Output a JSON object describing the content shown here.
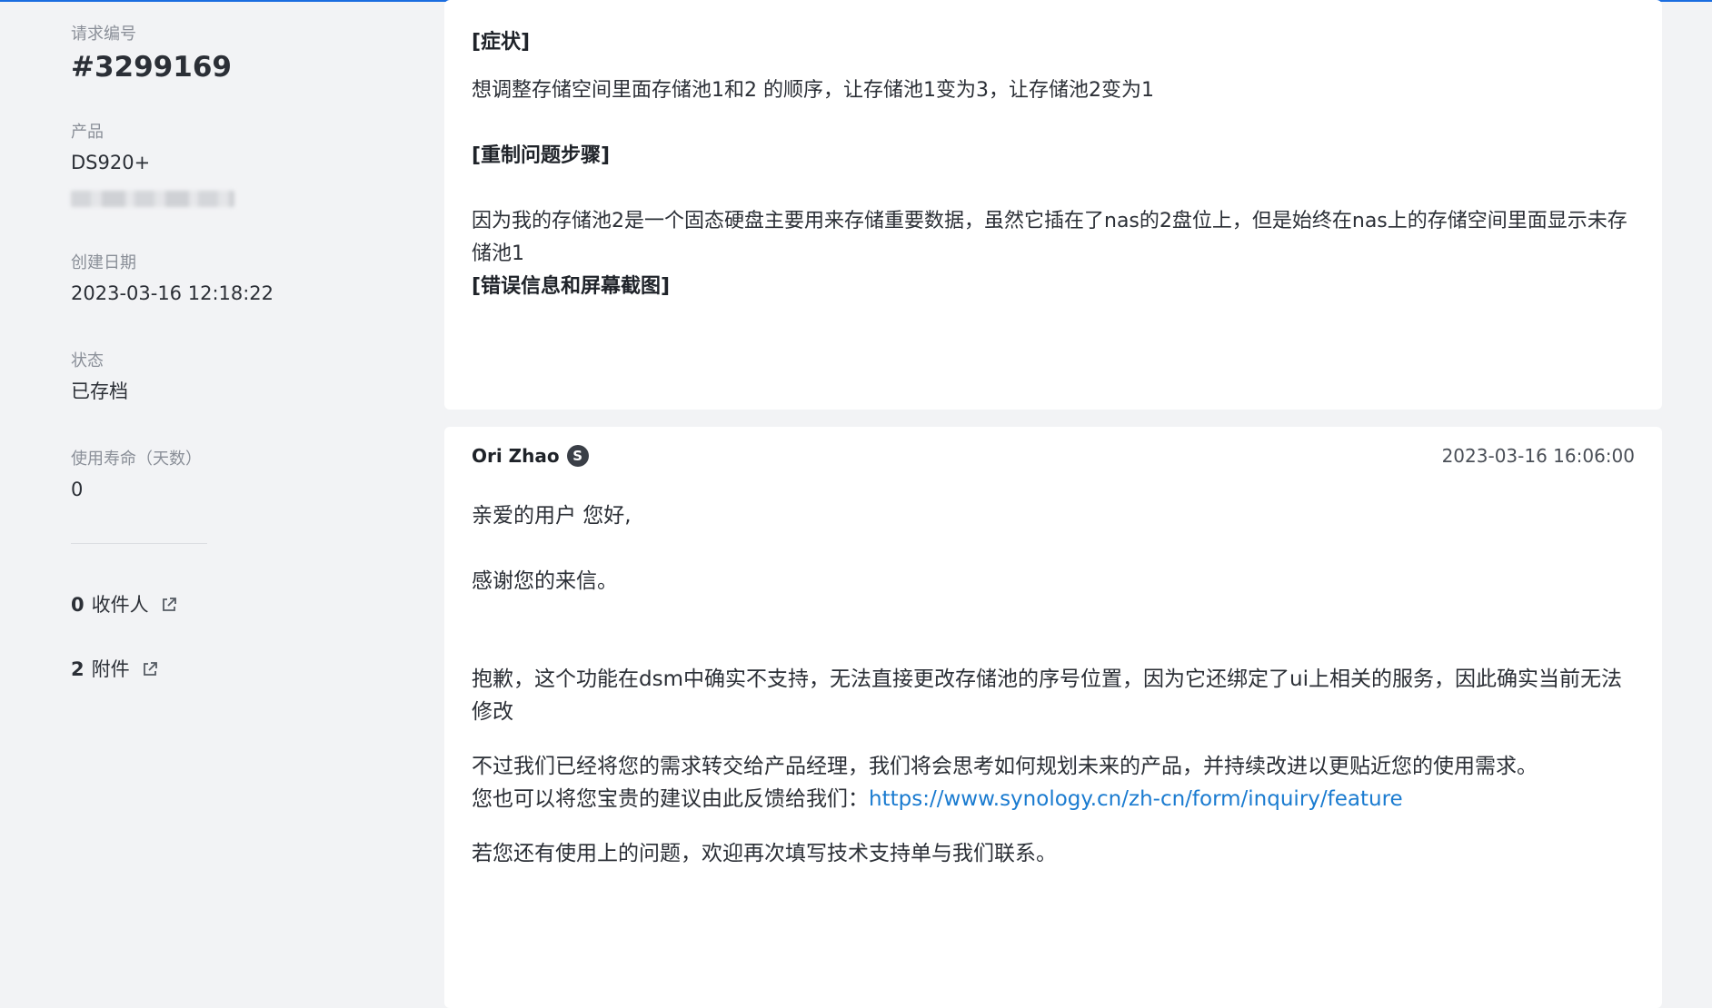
{
  "sidebar": {
    "request_id_label": "请求编号",
    "request_id": "#3299169",
    "product_label": "产品",
    "product_value": "DS920+",
    "created_label": "创建日期",
    "created_value": "2023-03-16 12:18:22",
    "status_label": "状态",
    "status_value": "已存档",
    "lifetime_label": "使用寿命（天数）",
    "lifetime_value": "0",
    "recipients_count": "0",
    "recipients_label": "收件人",
    "attachments_count": "2",
    "attachments_label": "附件"
  },
  "ticket": {
    "symptom_heading": "[症状]",
    "symptom_text": "想调整存储空间里面存储池1和2 的顺序，让存储池1变为3，让存储池2变为1",
    "repro_heading": "[重制问题步骤]",
    "repro_text": "因为我的存储池2是一个固态硬盘主要用来存储重要数据，虽然它插在了nas的2盘位上，但是始终在nas上的存储空间里面显示未存储池1",
    "error_heading": "[错误信息和屏幕截图]"
  },
  "reply": {
    "author": "Ori Zhao",
    "author_badge": "S",
    "timestamp": "2023-03-16 16:06:00",
    "greeting": "亲爱的用户 您好,",
    "thanks": "感谢您的来信。",
    "para1": "抱歉，这个功能在dsm中确实不支持，无法直接更改存储池的序号位置，因为它还绑定了ui上相关的服务，因此确实当前无法修改",
    "para2_line1": "不过我们已经将您的需求转交给产品经理，我们将会思考如何规划未来的产品，并持续改进以更贴近您的使用需求。",
    "para2_line2_prefix": "您也可以将您宝贵的建议由此反馈给我们：",
    "feedback_link": "https://www.synology.cn/zh-cn/form/inquiry/feature",
    "closing": "若您还有使用上的问题，欢迎再次填写技术支持单与我们联系。"
  },
  "colors": {
    "accent": "#1a6de0",
    "link": "#1a7bd0",
    "background": "#f2f3f5",
    "card": "#ffffff"
  },
  "icons": [
    "external-link-icon",
    "staff-badge-icon"
  ]
}
